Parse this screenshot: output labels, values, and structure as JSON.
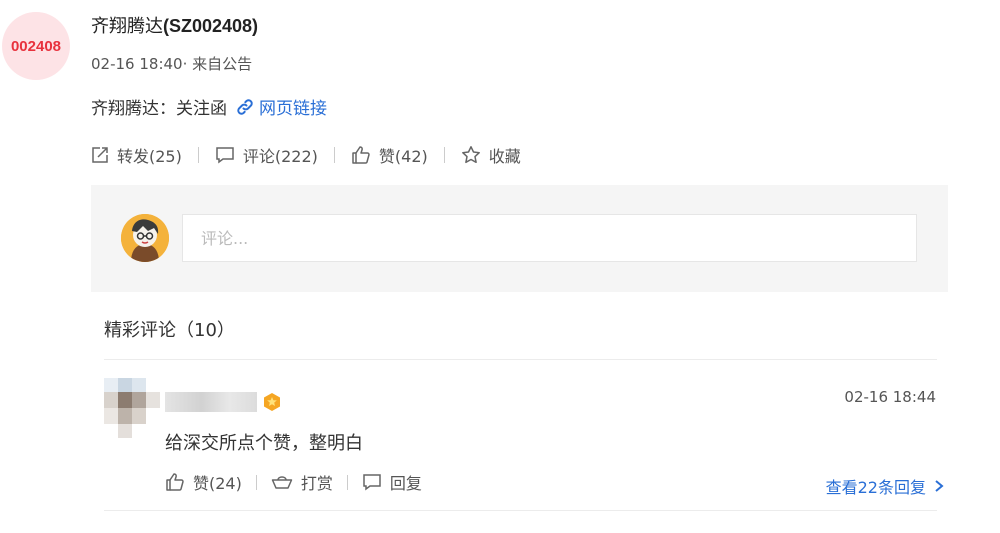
{
  "post": {
    "avatar_code": "002408",
    "author": "齐翔腾达",
    "author_code": "(SZ002408)",
    "time": "02-16 18:40",
    "source": "· 来自公告",
    "content": "齐翔腾达：关注函",
    "link_label": "网页链接"
  },
  "actions": {
    "repost": "转发(25)",
    "comment": "评论(222)",
    "like": "赞(42)",
    "favorite": "收藏"
  },
  "comment_box": {
    "placeholder": "评论..."
  },
  "hot_comments": {
    "title": "精彩评论（10）",
    "items": [
      {
        "time": "02-16 18:44",
        "text": "给深交所点个赞，整明白",
        "like": "赞(24)",
        "reward": "打赏",
        "reply": "回复",
        "view_replies": "查看22条回复"
      }
    ]
  },
  "colors": {
    "accent": "#2a6fd6",
    "avatar_bg": "#fde3e6",
    "avatar_text": "#e8323d"
  }
}
